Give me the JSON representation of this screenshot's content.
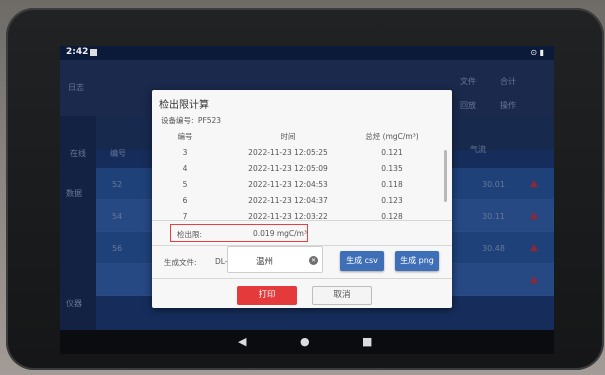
{
  "status": {
    "time": "2:42"
  },
  "background": {
    "header_left": "日志",
    "header_right_1": "文件",
    "header_right_2": "合计",
    "menu_1": "回放",
    "menu_2": "操作",
    "col_head": "在线",
    "col_head_2": "编号",
    "col_flow": "气流",
    "side_items": [
      "数据",
      "仪器"
    ],
    "row_ids": [
      "52",
      "54",
      "56"
    ],
    "row_vals": [
      "30.01",
      "30.11",
      "30.48"
    ]
  },
  "dialog": {
    "title": "检出限计算",
    "device_label": "设备编号:",
    "device_id": "PF523",
    "headers": [
      "编号",
      "时间",
      "总烃 (mgC/m³)"
    ],
    "rows": [
      {
        "no": "3",
        "time": "2022-11-23 12:05:25",
        "value": "0.121"
      },
      {
        "no": "4",
        "time": "2022-11-23 12:05:09",
        "value": "0.135"
      },
      {
        "no": "5",
        "time": "2022-11-23 12:04:53",
        "value": "0.118"
      },
      {
        "no": "6",
        "time": "2022-11-23 12:04:37",
        "value": "0.123"
      },
      {
        "no": "7",
        "time": "2022-11-23 12:03:22",
        "value": "0.128"
      }
    ],
    "limit_label": "检出限:",
    "limit_value": "0.019 mgC/m³",
    "gen_label": "生成文件:",
    "gen_prefix": "DL-",
    "file_value": "温州",
    "csv_button": "生成 csv",
    "png_button": "生成 png",
    "print_button": "打印",
    "cancel_button": "取消"
  }
}
